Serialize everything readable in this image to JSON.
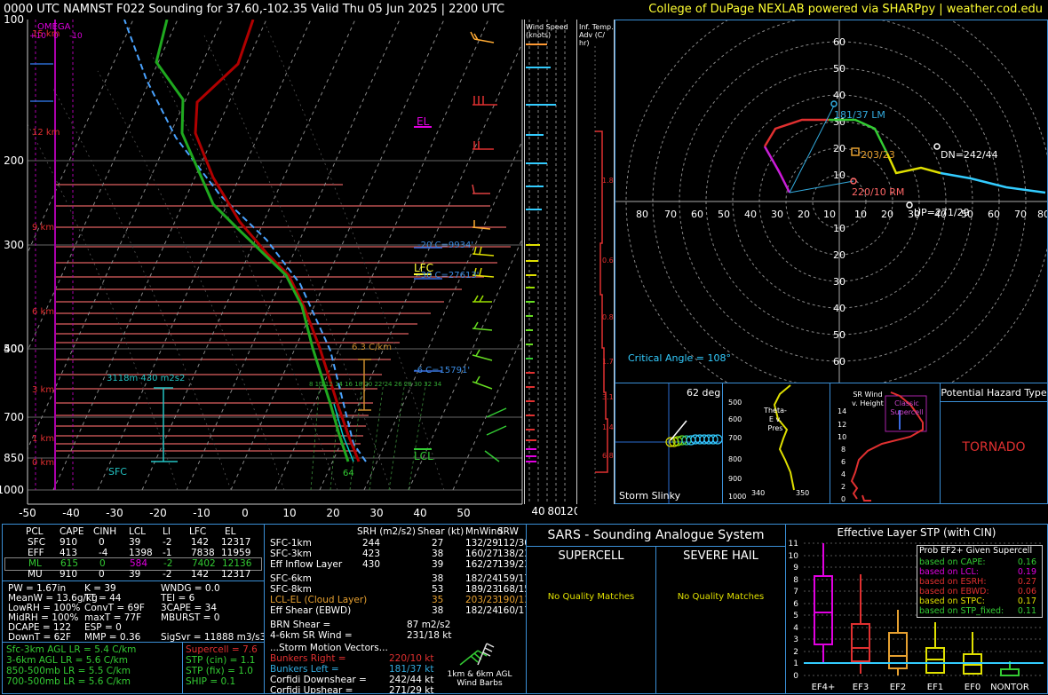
{
  "header": {
    "title": "0000 UTC NAMNST F022 Sounding for 37.60,-102.35 Valid  Thu 05 Jun 2025 | 2200 UTC",
    "credit": "College of DuPage NEXLAB powered via SHARPpy | weather.cod.edu"
  },
  "skewt": {
    "pressure_ticks": [
      "100",
      "200",
      "300",
      "400",
      "500",
      "700",
      "850",
      "1000"
    ],
    "temp_ticks": [
      "-50",
      "-40",
      "-30",
      "-20",
      "-10",
      "0",
      "10",
      "20",
      "30",
      "40",
      "50"
    ],
    "height_labels": [
      "15 km",
      "12 km",
      "9 km",
      "6 km",
      "3 km",
      "1 km",
      "0 km"
    ],
    "omega_label": "OMEGA",
    "omega_ticks": [
      "+10",
      "0",
      "-10"
    ],
    "el_label": "EL",
    "lfc_label": "LFC",
    "lcl_label": "LCL",
    "level_labels": [
      "-20 C=9934'",
      "-30 C=27613'",
      "-6 C=15791'"
    ],
    "lapse_label": "6.3 C/km",
    "effective_layer_label": "3118m    430 m2s2",
    "sfc_label": "SFC",
    "td_sfc_label": "64",
    "wetbulb_numbers": "8 10 12 14 16 18 20 22 24 26 28 30 32 34"
  },
  "wind_speed_panel": {
    "title": "Wind Speed (knots)",
    "ticks": [
      "40",
      "80",
      "120"
    ]
  },
  "temp_adv_panel": {
    "title": "Inf. Temp. Adv (C/ hr)",
    "values": [
      "1.8",
      "0.6",
      "0.8",
      "1.7",
      "3.1",
      "1.4",
      "6.8"
    ]
  },
  "hodograph": {
    "ring_labels_top": [
      "60",
      "50",
      "40",
      "30",
      "20",
      "10"
    ],
    "ring_labels_bottom": [
      "10",
      "20",
      "30",
      "40",
      "50",
      "60"
    ],
    "axis_labels_left": [
      "80",
      "70",
      "60",
      "50",
      "40",
      "30",
      "20",
      "10"
    ],
    "axis_labels_right": [
      "10",
      "20",
      "30",
      "40",
      "50",
      "60",
      "70",
      "80"
    ],
    "lm_label": "181/37 LM",
    "rm_label": "220/10 RM",
    "mean_wind_label": "203/23",
    "dn_label": "DN=242/44",
    "up_label": "UP=271/29",
    "critical_angle": "Critical Angle = 108°"
  },
  "storm_slinky": {
    "angle": "62 deg",
    "label": "Storm Slinky"
  },
  "theta_e": {
    "title": "Theta-E v. Pres",
    "pressure_ticks": [
      "500",
      "600",
      "700",
      "800",
      "900",
      "1000"
    ],
    "x_ticks": [
      "340",
      "350"
    ]
  },
  "sr_wind": {
    "title": "SR Wind v. Height",
    "height_ticks": [
      "14",
      "12",
      "10",
      "8",
      "6",
      "4",
      "2",
      "0"
    ],
    "classic_label": "Classic Supercell"
  },
  "hazard": {
    "title": "Potential Hazard Type",
    "value": "TORNADO"
  },
  "thermo_table": {
    "headers": [
      "PCL",
      "CAPE",
      "CINH",
      "LCL",
      "LI",
      "LFC",
      "EL"
    ],
    "rows": [
      [
        "SFC",
        "910",
        "0",
        "39",
        "-2",
        "142",
        "12317"
      ],
      [
        "EFF",
        "413",
        "-4",
        "1398",
        "-1",
        "7838",
        "11959"
      ],
      [
        "ML",
        "615",
        "0",
        "584",
        "-2",
        "7402",
        "12136"
      ],
      [
        "MU",
        "910",
        "0",
        "39",
        "-2",
        "142",
        "12317"
      ]
    ],
    "indices": [
      [
        "PW = 1.67in",
        "K = 39",
        "WNDG = 0.0"
      ],
      [
        "MeanW = 13.6g/kg",
        "TT = 44",
        "TEI = 6"
      ],
      [
        "LowRH = 100%",
        "ConvT = 69F",
        "3CAPE = 34"
      ],
      [
        "MidRH = 100%",
        "maxT = 77F",
        "MBURST = 0"
      ],
      [
        "DCAPE = 122",
        "ESP = 0",
        ""
      ],
      [
        "DownT = 62F",
        "MMP = 0.36",
        "SigSvr = 11888 m3/s3"
      ]
    ],
    "lapse_rates": [
      "Sfc-3km AGL LR = 5.4 C/km",
      "3-6km AGL LR = 5.6 C/km",
      "850-500mb LR = 5.5 C/km",
      "700-500mb LR = 5.6 C/km"
    ],
    "composites": [
      "Supercell = 7.6",
      "STP (cin) = 1.1",
      "STP (fix) = 1.0",
      "SHIP = 0.1"
    ]
  },
  "kinematic_table": {
    "headers": [
      "SRH (m2/s2)",
      "Shear (kt)",
      "MnWind",
      "SRW"
    ],
    "rows": [
      [
        "SFC-1km",
        "244",
        "27",
        "132/29",
        "112/30"
      ],
      [
        "SFC-3km",
        "423",
        "38",
        "160/27",
        "138/23"
      ],
      [
        "Eff Inflow Layer",
        "430",
        "39",
        "162/27",
        "139/23"
      ],
      [
        "SFC-6km",
        "",
        "38",
        "182/24",
        "159/17"
      ],
      [
        "SFC-8km",
        "",
        "53",
        "189/23",
        "168/15"
      ],
      [
        "LCL-EL (Cloud Layer)",
        "",
        "35",
        "203/23",
        "190/13"
      ],
      [
        "Eff Shear (EBWD)",
        "",
        "38",
        "182/24",
        "160/17"
      ]
    ],
    "brn": [
      "BRN Shear =",
      "87 m2/s2"
    ],
    "sfc46": [
      "4-6km SR Wind =",
      "231/18 kt"
    ],
    "storm_title": "...Storm Motion Vectors...",
    "storm_motion": [
      [
        "Bunkers Right =",
        "220/10 kt"
      ],
      [
        "Bunkers Left =",
        "181/37 kt"
      ],
      [
        "Corfidi Downshear =",
        "242/44 kt"
      ],
      [
        "Corfidi Upshear =",
        "271/29 kt"
      ]
    ],
    "barbs_label": "1km & 6km AGL Wind Barbs"
  },
  "sars": {
    "title": "SARS - Sounding Analogue System",
    "supercell_title": "SUPERCELL",
    "hail_title": "SEVERE HAIL",
    "supercell_result": "No Quality Matches",
    "hail_result": "No Quality Matches"
  },
  "stp": {
    "title": "Effective Layer STP (with CIN)",
    "y_ticks": [
      "11",
      "10",
      "9",
      "8",
      "7",
      "6",
      "5",
      "4",
      "3",
      "2",
      "1",
      "0"
    ],
    "categories": [
      "EF4+",
      "EF3",
      "EF2",
      "EF1",
      "EF0",
      "NONTOR"
    ],
    "legend_title": "Prob EF2+ Given Supercell",
    "legend": [
      [
        "based on CAPE:",
        "0.16"
      ],
      [
        "based on LCL:",
        "0.19"
      ],
      [
        "based on ESRH:",
        "0.27"
      ],
      [
        "based on EBWD:",
        "0.06"
      ],
      [
        "based on STPC:",
        "0.17"
      ],
      [
        "based on STP_fixed:",
        "0.11"
      ]
    ]
  }
}
